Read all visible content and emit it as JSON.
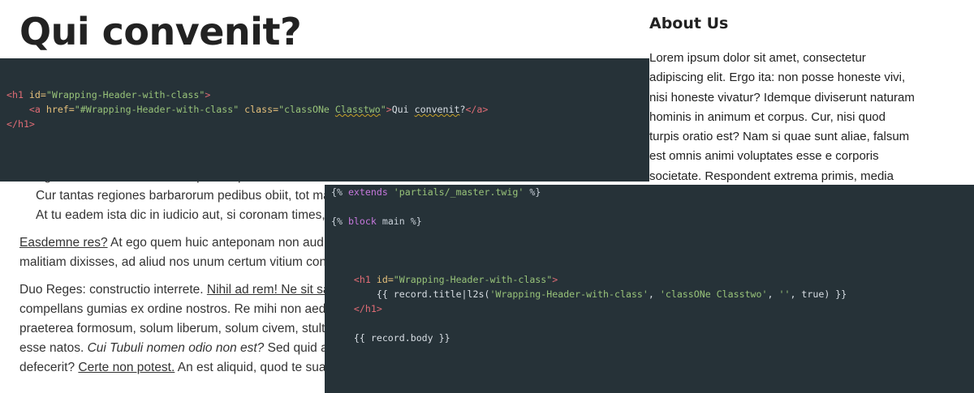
{
  "article": {
    "title": "Qui convenit?",
    "bullets": [
      "Age nunc isti doceant, vel tu potius quis enim ista melius.",
      "Cur tantas regiones barbarorum pedibus obiit, tot maria",
      "At tu eadem ista dic in iudicio aut, si coronam times,"
    ],
    "para1": {
      "link": "Easdemne res?",
      "rest_line1": " At ego quem huic anteponam non aud",
      "line2": "malitiam dixisses, ad aliud nos unum certum vitium con"
    },
    "para2": {
      "intro": "Duo Reges: constructio interrete. ",
      "link1": "Nihil ad rem! Ne sit sa",
      "line2": "compellans gumias ex ordine nostros. Re mihi non aed",
      "line3": "praeterea formosum, solum liberum, solum civem, stult",
      "line4_pre": "esse natos. ",
      "line4_em": "Cui Tubuli nomen odio non est?",
      "line4_post": " Sed quid a",
      "line5_pre": "defecerit? ",
      "line5_link": "Certe non potest.",
      "line5_post": " An est aliquid, quod te sua"
    }
  },
  "sidebar": {
    "heading": "About Us",
    "lines": [
      "Lorem ipsum dolor sit amet, consectetur",
      "adipiscing elit. Ergo ita: non posse honeste vivi,",
      "nisi honeste vivatur? Idemque diviserunt naturam",
      "hominis in animum et corpus. Cur, nisi quod",
      "turpis oratio est? Nam si quae sunt aliae, falsum",
      "est omnis animi voluptates esse e corporis",
      "societate. Respondent extrema primis, media"
    ]
  },
  "code_html": {
    "l1_open": "<h1",
    "l1_attr": " id=",
    "l1_str": "\"Wrapping-Header-with-class\"",
    "l1_close": ">",
    "l2_indent": "    ",
    "l2_open": "<a",
    "l2_attr1": " href=",
    "l2_str1": "\"#Wrapping-Header-with-class\"",
    "l2_attr2": " class=",
    "l2_str2a": "\"classONe ",
    "l2_str2b": "Classtwo",
    "l2_str2c": "\"",
    "l2_gt": ">",
    "l2_txt1": "Qui ",
    "l2_txt2": "convenit",
    "l2_txt3": "?",
    "l2_end": "</a>",
    "l3": "</h1>"
  },
  "code_twig": {
    "l1_a": "{% ",
    "l1_kw": "extends",
    "l1_str": " 'partials/_master.twig'",
    "l1_b": " %}",
    "l2_a": "{% ",
    "l2_kw": "block",
    "l2_b": " main %}",
    "l3_indent": "    ",
    "l3_open": "<h1",
    "l3_attr": " id=",
    "l3_str": "\"Wrapping-Header-with-class\"",
    "l3_close": ">",
    "l4_indent": "        ",
    "l4_a": "{{ record.title|l2s(",
    "l4_s1": "'Wrapping-Header-with-class'",
    "l4_c1": ", ",
    "l4_s2": "'classONe Classtwo'",
    "l4_c2": ", ",
    "l4_s3": "''",
    "l4_b": ", true) }}",
    "l5_indent": "    ",
    "l5": "</h1>",
    "l6_indent": "    ",
    "l6": "{{ record.body }}"
  }
}
